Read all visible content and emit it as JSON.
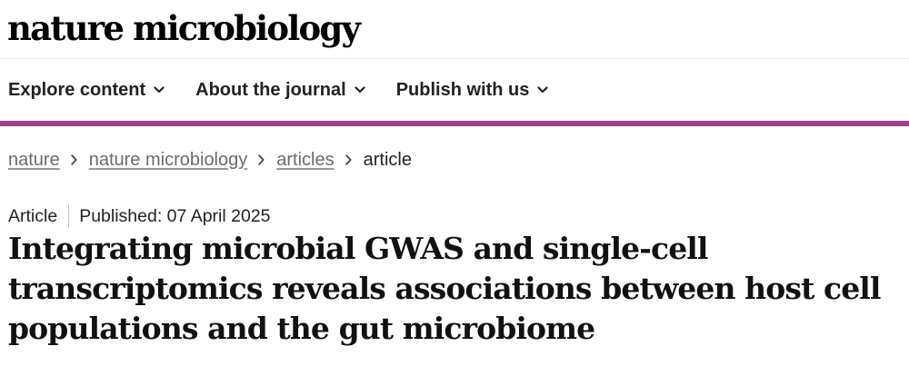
{
  "header": {
    "logo_text": "nature microbiology"
  },
  "nav": {
    "items": [
      {
        "label": "Explore content",
        "icon": "chevron-down-icon"
      },
      {
        "label": "About the journal",
        "icon": "chevron-down-icon"
      },
      {
        "label": "Publish with us",
        "icon": "chevron-down-icon"
      }
    ]
  },
  "colors": {
    "accent": "#9b3f8f",
    "link": "#6b6b6b",
    "text": "#222222"
  },
  "breadcrumb": {
    "items": [
      {
        "label": "nature",
        "link": true
      },
      {
        "label": "nature microbiology",
        "link": true
      },
      {
        "label": "articles",
        "link": true
      },
      {
        "label": "article",
        "link": false
      }
    ],
    "separator_icon": "chevron-right-icon"
  },
  "article": {
    "type": "Article",
    "published": "Published: 07 April 2025",
    "title": "Integrating microbial GWAS and single-cell transcriptomics reveals associations between host cell populations and the gut microbiome"
  }
}
